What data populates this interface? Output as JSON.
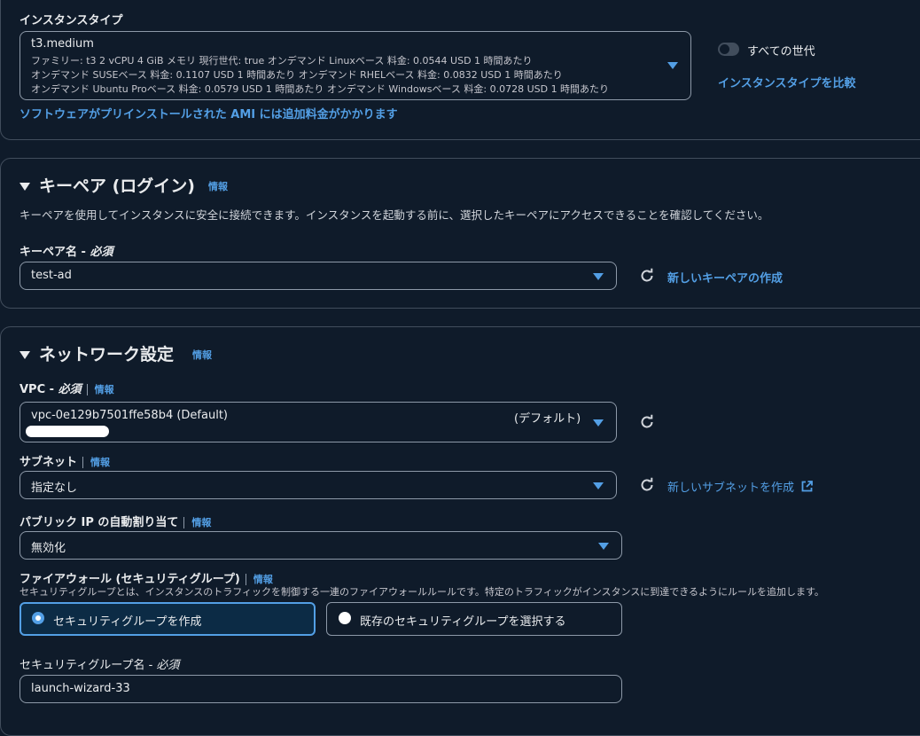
{
  "instance_type": {
    "label": "インスタンスタイプ",
    "name": "t3.medium",
    "detail_line1": "ファミリー: t3    2 vCPU    4 GiB メモリ    現行世代: true        オンデマンド Linuxベース 料金: 0.0544 USD 1 時間あたり",
    "detail_line2": "オンデマンド SUSEベース 料金: 0.1107 USD 1 時間あたり    オンデマンド RHELベース 料金: 0.0832 USD 1 時間あたり",
    "detail_line3": "オンデマンド Ubuntu Proベース 料金: 0.0579 USD 1 時間あたり    オンデマンド Windowsベース 料金: 0.0728 USD 1 時間あたり",
    "all_generations_label": "すべての世代",
    "all_generations_on": false,
    "compare_link": "インスタンスタイプを比較",
    "ami_note": "ソフトウェアがプリインストールされた AMI には追加料金がかかります"
  },
  "key_pair": {
    "title": "キーペア (ログイン)",
    "info": "情報",
    "description": "キーペアを使用してインスタンスに安全に接続できます。インスタンスを起動する前に、選択したキーペアにアクセスできることを確認してください。",
    "name_label": "キーペア名 - ",
    "required": "必須",
    "value": "test-ad",
    "create_link": "新しいキーペアの作成"
  },
  "network": {
    "title": "ネットワーク設定",
    "info": "情報",
    "vpc_label": "VPC - ",
    "vpc_required": "必須",
    "vpc_value": "vpc-0e129b7501ffe58b4 (Default)",
    "vpc_default_tag": "(デフォルト)",
    "subnet_label": "サブネット",
    "subnet_value": "指定なし",
    "subnet_create_link": "新しいサブネットを作成",
    "public_ip_label": "パブリック IP の自動割り当て",
    "public_ip_value": "無効化",
    "firewall_label": "ファイアウォール (セキュリティグループ)",
    "firewall_desc": "セキュリティグループとは、インスタンスのトラフィックを制御する一連のファイアウォールルールです。特定のトラフィックがインスタンスに到達できるようにルールを追加します。",
    "sg_option_create": "セキュリティグループを作成",
    "sg_option_existing": "既存のセキュリティグループを選択する",
    "sg_name_label": "セキュリティグループ名 - ",
    "sg_name_required": "必須",
    "sg_name_value": "launch-wizard-33"
  },
  "colors": {
    "accent": "#539fe5",
    "background": "#0f1b2a",
    "border": "#8d99a8"
  }
}
